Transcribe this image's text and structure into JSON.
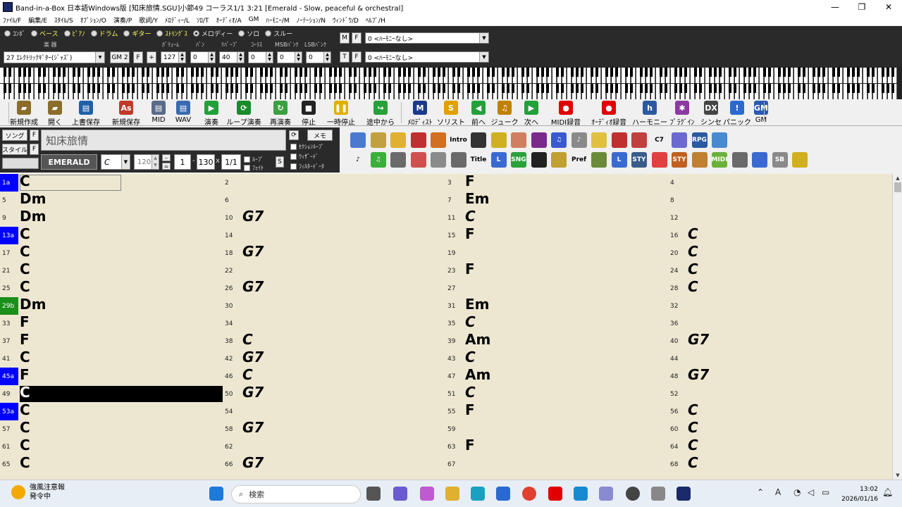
{
  "window": {
    "title": "Band-in-a-Box 日本語Windows版 [知床旅情.SGU]小節49 コーラス1/1  3:21  [Emerald - Slow, peaceful & orchestral]",
    "min": "—",
    "max": "❐",
    "close": "✕"
  },
  "menu": [
    "ﾌｧｲﾙ/F",
    "編集/E",
    "ｽﾀｲﾙ/S",
    "ｵﾌﾟｼｮﾝ/O",
    "演奏/P",
    "歌詞/Y",
    "ﾒﾛﾃﾞｨｰ/L",
    "ｿﾛ/T",
    "ｵｰﾃﾞｨｵ/A",
    "GM",
    "ﾊｰﾓﾆｰ/M",
    "ﾉｰﾃｰｼｮﾝ/N",
    "ｳｨﾝﾄﾞｳ/D",
    "ﾍﾙﾌﾟ/H"
  ],
  "tracks": [
    {
      "label": "ｺﾝﾎﾞ",
      "selected": false
    },
    {
      "label": "ベース",
      "selected": false
    },
    {
      "label": "ﾋﾟｱﾉ",
      "selected": false
    },
    {
      "label": "ドラム",
      "selected": false
    },
    {
      "label": "ギター",
      "selected": false
    },
    {
      "label": "ｽﾄﾘﾝｸﾞｽ",
      "selected": false
    },
    {
      "label": "メロディー",
      "selected": true
    },
    {
      "label": "ソロ",
      "selected": false
    },
    {
      "label": "スルー",
      "selected": false
    }
  ],
  "mixer": {
    "labels": {
      "instrument": "楽 器",
      "volume": "ﾎﾞﾘｭｰﾑ",
      "pan": "ﾊﾟﾝ",
      "reverb": "ﾘﾊﾞｰﾌﾞ",
      "chorus": "ｺｰﾗｽ",
      "msb": "MSBﾊﾞﾝｸ",
      "lsb": "LSBﾊﾞﾝｸ"
    },
    "instrument": "27 ｴﾚｸﾄﾘｯｸｷﾞﾀｰ(ｼﾞｬｽﾞ)",
    "gm": "GM 2",
    "f": "F",
    "plus": "+",
    "volume": "127",
    "pan": "0",
    "reverb": "40",
    "chorus": "0",
    "msb": "0",
    "lsb": "0"
  },
  "harmony": {
    "m": "M",
    "t": "T",
    "f": "F",
    "value1": "0 <ﾊｰﾓﾆｰなし>",
    "value2": "0 <ﾊｰﾓﾆｰなし>"
  },
  "toolbar": [
    {
      "id": "new",
      "label": "新規作成",
      "icon": "folder-icon",
      "color": "#8a6d2a"
    },
    {
      "id": "open",
      "label": "開く",
      "icon": "open-folder-icon",
      "color": "#8a6d2a"
    },
    {
      "id": "save",
      "label": "上書保存",
      "icon": "floppy-icon",
      "color": "#1e5fa8"
    },
    {
      "id": "saveas",
      "label": "新規保存",
      "icon": "save-as-icon",
      "color": "#c0392b"
    },
    {
      "id": "mid",
      "label": "MID",
      "icon": "midi-save-icon",
      "color": "#5a6a8a"
    },
    {
      "id": "wav",
      "label": "WAV",
      "icon": "wav-save-icon",
      "color": "#3a6ab0"
    },
    {
      "id": "play",
      "label": "演奏",
      "icon": "play-icon",
      "color": "#22a03a"
    },
    {
      "id": "loop",
      "label": "ループ演奏",
      "icon": "loop-icon",
      "color": "#1a8a2a"
    },
    {
      "id": "replay",
      "label": "再演奏",
      "icon": "replay-icon",
      "color": "#3aa040"
    },
    {
      "id": "stop",
      "label": "停止",
      "icon": "stop-icon",
      "color": "#222"
    },
    {
      "id": "pause",
      "label": "一時停止",
      "icon": "pause-icon",
      "color": "#e0b000"
    },
    {
      "id": "playfrom",
      "label": "途中から",
      "icon": "play-from-icon",
      "color": "#2aa03a"
    },
    {
      "id": "melodist",
      "label": "ﾒﾛﾃﾞｨｽﾄ",
      "icon": "melodist-icon",
      "color": "#1a3a8a"
    },
    {
      "id": "soloist",
      "label": "ソリスト",
      "icon": "soloist-icon",
      "color": "#e0a000"
    },
    {
      "id": "prev",
      "label": "前へ",
      "icon": "arrow-left-icon",
      "color": "#22a03a"
    },
    {
      "id": "jukebox",
      "label": "ジューク",
      "icon": "jukebox-icon",
      "color": "#c08000"
    },
    {
      "id": "next",
      "label": "次へ",
      "icon": "arrow-right-icon",
      "color": "#22a03a"
    },
    {
      "id": "midirec",
      "label": "MIDI録音",
      "icon": "record-icon",
      "color": "#e00000"
    },
    {
      "id": "audiorec",
      "label": "ｵｰﾃﾞｨｵ録音",
      "icon": "audio-record-icon",
      "color": "#e00000"
    },
    {
      "id": "harmony",
      "label": "ハーモニー",
      "icon": "harmony-icon",
      "color": "#2a5aa0"
    },
    {
      "id": "plugin",
      "label": "ﾌﾟﾗｸﾞｲﾝ",
      "icon": "plugin-icon",
      "color": "#8a3aa0"
    },
    {
      "id": "synth",
      "label": "シンセ",
      "icon": "synth-icon",
      "color": "#444"
    },
    {
      "id": "panic",
      "label": "パニック",
      "icon": "panic-icon",
      "color": "#2a6ad0"
    },
    {
      "id": "gm",
      "label": "GM",
      "icon": "gm-icon",
      "color": "#2a5ab0"
    }
  ],
  "song": {
    "song_btn": "ソング",
    "style_btn": "スタイル",
    "f": "F",
    "title": "知床旅情",
    "memo": "メモ",
    "style": "EMERALD",
    "key": "C",
    "tempo": "120",
    "start": "1",
    "end": "130",
    "chorus": "1/1",
    "loop": "ﾙｰﾌﾟ",
    "feigh": "ﾌｪｲﾄ",
    "s": "S",
    "checks": [
      "ｾｸｼｮﾝﾙｰﾌﾟ",
      "ｳｨｻﾞｰﾄﾞ",
      "ﾌｨﾙﾀｰﾄﾞｰﾀ"
    ]
  },
  "icons_grid": [
    {
      "name": "copy-icon",
      "color": "#4a7ad0",
      "t": ""
    },
    {
      "name": "paste-icon",
      "color": "#c0a040",
      "t": ""
    },
    {
      "name": "folder-open-icon",
      "color": "#e0b030",
      "t": ""
    },
    {
      "name": "favorite-icon",
      "color": "#c03030",
      "t": ""
    },
    {
      "name": "guitar-icon",
      "color": "#d07020",
      "t": ""
    },
    {
      "name": "intro-icon",
      "color": "#f0f0f0",
      "t": "Intro"
    },
    {
      "name": "piano-keys-icon",
      "color": "#333",
      "t": ""
    },
    {
      "name": "lemon-icon",
      "color": "#d0b020",
      "t": ""
    },
    {
      "name": "ear-icon",
      "color": "#d08060",
      "t": ""
    },
    {
      "name": "eggplant-icon",
      "color": "#7a2a8a",
      "t": ""
    },
    {
      "name": "notes-grid-icon",
      "color": "#3a5ad0",
      "t": "♫"
    },
    {
      "name": "note-box-icon",
      "color": "#8a8a8a",
      "t": "♪"
    },
    {
      "name": "lyrics-icon",
      "color": "#e0c040",
      "t": ""
    },
    {
      "name": "ev-icon",
      "color": "#c03030",
      "t": ""
    },
    {
      "name": "grid-icon",
      "color": "#c04040",
      "t": ""
    },
    {
      "name": "c7-icon",
      "color": "#f0f0f0",
      "t": "C7"
    },
    {
      "name": "globe-icon",
      "color": "#6a6ad0",
      "t": ""
    },
    {
      "name": "rpg-icon",
      "color": "#2a5aa0",
      "t": "RPG"
    },
    {
      "name": "mixer-icon",
      "color": "#4a8ad0",
      "t": ""
    },
    {
      "name": "eighth-note-icon",
      "color": "#f0f0f0",
      "t": "♪"
    },
    {
      "name": "music-green-icon",
      "color": "#3ab03a",
      "t": "♫"
    },
    {
      "name": "drum-icon",
      "color": "#6a6a6a",
      "t": ""
    },
    {
      "name": "waveform-icon",
      "color": "#d05050",
      "t": ""
    },
    {
      "name": "printer-icon",
      "color": "#8a8a8a",
      "t": ""
    },
    {
      "name": "clock-icon",
      "color": "#6a6a6a",
      "t": ""
    },
    {
      "name": "title-icon",
      "color": "#f0f0f0",
      "t": "Title"
    },
    {
      "name": "l-icon",
      "color": "#3a6ad0",
      "t": "L"
    },
    {
      "name": "song-icon",
      "color": "#2aa03a",
      "t": "SNG"
    },
    {
      "name": "sax-icon",
      "color": "#222",
      "t": ""
    },
    {
      "name": "mic-icon",
      "color": "#c0a030",
      "t": ""
    },
    {
      "name": "pref-icon",
      "color": "#f0f0f0",
      "t": "Pref"
    },
    {
      "name": "bars-icon",
      "color": "#6a8a3a",
      "t": ""
    },
    {
      "name": "l2-icon",
      "color": "#3a6ad0",
      "t": "L"
    },
    {
      "name": "sty-box-icon",
      "color": "#3a5a8a",
      "t": "STY"
    },
    {
      "name": "pill-icon",
      "color": "#e04040",
      "t": ""
    },
    {
      "name": "sty-icon",
      "color": "#c06020",
      "t": "STY"
    },
    {
      "name": "tuner-icon",
      "color": "#c08030",
      "t": ""
    },
    {
      "name": "midi-icon",
      "color": "#6ab03a",
      "t": "MIDI"
    },
    {
      "name": "wrench-icon",
      "color": "#6a6a6a",
      "t": ""
    },
    {
      "name": "pillar-icon",
      "color": "#3a6ad0",
      "t": ""
    },
    {
      "name": "sb-icon",
      "color": "#8a8a8a",
      "t": "SB"
    },
    {
      "name": "lemon-sax-icon",
      "color": "#d0b020",
      "t": ""
    }
  ],
  "bars": [
    {
      "n": "1a",
      "c": "C",
      "part": "a"
    },
    {
      "n": "2",
      "c": ""
    },
    {
      "n": "3",
      "c": "F"
    },
    {
      "n": "4",
      "c": ""
    },
    {
      "n": "5",
      "c": "Dm"
    },
    {
      "n": "6",
      "c": ""
    },
    {
      "n": "7",
      "c": "Em"
    },
    {
      "n": "8",
      "c": ""
    },
    {
      "n": "9",
      "c": "Dm"
    },
    {
      "n": "10",
      "c": "G7"
    },
    {
      "n": "11",
      "c": "C"
    },
    {
      "n": "12",
      "c": ""
    },
    {
      "n": "13a",
      "c": "C",
      "part": "a"
    },
    {
      "n": "14",
      "c": ""
    },
    {
      "n": "15",
      "c": "F"
    },
    {
      "n": "16",
      "c": "C"
    },
    {
      "n": "17",
      "c": "C"
    },
    {
      "n": "18",
      "c": "G7"
    },
    {
      "n": "19",
      "c": ""
    },
    {
      "n": "20",
      "c": "C"
    },
    {
      "n": "21",
      "c": "C"
    },
    {
      "n": "22",
      "c": ""
    },
    {
      "n": "23",
      "c": "F"
    },
    {
      "n": "24",
      "c": "C"
    },
    {
      "n": "25",
      "c": "C"
    },
    {
      "n": "26",
      "c": "G7"
    },
    {
      "n": "27",
      "c": ""
    },
    {
      "n": "28",
      "c": "C"
    },
    {
      "n": "29b",
      "c": "Dm",
      "part": "b"
    },
    {
      "n": "30",
      "c": ""
    },
    {
      "n": "31",
      "c": "Em"
    },
    {
      "n": "32",
      "c": ""
    },
    {
      "n": "33",
      "c": "F"
    },
    {
      "n": "34",
      "c": ""
    },
    {
      "n": "35",
      "c": "C"
    },
    {
      "n": "36",
      "c": ""
    },
    {
      "n": "37",
      "c": "F"
    },
    {
      "n": "38",
      "c": "C"
    },
    {
      "n": "39",
      "c": "Am"
    },
    {
      "n": "40",
      "c": "G7"
    },
    {
      "n": "41",
      "c": "C"
    },
    {
      "n": "42",
      "c": "G7"
    },
    {
      "n": "43",
      "c": "C"
    },
    {
      "n": "44",
      "c": ""
    },
    {
      "n": "45a",
      "c": "F",
      "part": "a"
    },
    {
      "n": "46",
      "c": "C"
    },
    {
      "n": "47",
      "c": "Am"
    },
    {
      "n": "48",
      "c": "G7"
    },
    {
      "n": "49",
      "c": "C",
      "selected": true
    },
    {
      "n": "50",
      "c": "G7"
    },
    {
      "n": "51",
      "c": "C"
    },
    {
      "n": "52",
      "c": ""
    },
    {
      "n": "53a",
      "c": "C",
      "part": "a"
    },
    {
      "n": "54",
      "c": ""
    },
    {
      "n": "55",
      "c": "F"
    },
    {
      "n": "56",
      "c": "C"
    },
    {
      "n": "57",
      "c": "C"
    },
    {
      "n": "58",
      "c": "G7"
    },
    {
      "n": "59",
      "c": ""
    },
    {
      "n": "60",
      "c": "C"
    },
    {
      "n": "61",
      "c": "C"
    },
    {
      "n": "62",
      "c": ""
    },
    {
      "n": "63",
      "c": "F"
    },
    {
      "n": "64",
      "c": "C"
    },
    {
      "n": "65",
      "c": "C"
    },
    {
      "n": "66",
      "c": "G7"
    },
    {
      "n": "67",
      "c": ""
    },
    {
      "n": "68",
      "c": "C"
    }
  ],
  "taskbar": {
    "weather_title": "強風注意報",
    "weather_sub": "発令中",
    "search": "検索",
    "time": "13:02",
    "date": "2026/01/16",
    "ime": "A"
  }
}
